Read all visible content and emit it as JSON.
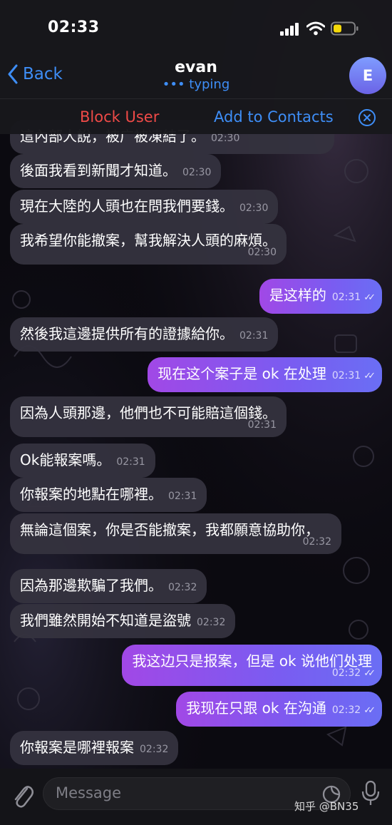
{
  "status_bar": {
    "time": "02:33"
  },
  "nav": {
    "back_label": "Back",
    "title": "evan",
    "subtitle": "typing",
    "avatar_initial": "E"
  },
  "actions": {
    "block_label": "Block User",
    "add_label": "Add to Contacts"
  },
  "messages": [
    {
      "dir": "in",
      "text": "這內部人說，被广被凍結了。",
      "time": "02:30"
    },
    {
      "dir": "in",
      "text": "後面我看到新聞才知道。",
      "time": "02:30"
    },
    {
      "dir": "in",
      "text": "現在大陸的人頭也在問我們要錢。",
      "time": "02:30"
    },
    {
      "dir": "in",
      "text": "我希望你能撤案，幫我解決人頭的麻煩。",
      "time": "02:30"
    },
    {
      "dir": "out",
      "text": "是这样的",
      "time": "02:31"
    },
    {
      "dir": "in",
      "text": "然後我這邊提供所有的證據給你。",
      "time": "02:31"
    },
    {
      "dir": "out",
      "text": "现在这个案子是 ok 在处理",
      "time": "02:31"
    },
    {
      "dir": "in",
      "text": "因為人頭那邊，他們也不可能賠這個錢。",
      "time": "02:31"
    },
    {
      "dir": "in",
      "text": "Ok能報案嗎。",
      "time": "02:31"
    },
    {
      "dir": "in",
      "text": "你報案的地點在哪裡。",
      "time": "02:31"
    },
    {
      "dir": "in",
      "text": "無論這個案，你是否能撤案，我都願意協助你，",
      "time": "02:32"
    },
    {
      "dir": "in",
      "text": "因為那邊欺騙了我們。",
      "time": "02:32"
    },
    {
      "dir": "in",
      "text": "我們雖然開始不知道是盜號",
      "time": "02:32"
    },
    {
      "dir": "out",
      "text": "我这边只是报案，但是 ok 说他们处理",
      "time": "02:32"
    },
    {
      "dir": "out",
      "text": "我现在只跟 ok 在沟通",
      "time": "02:32"
    },
    {
      "dir": "in",
      "text": "你報案是哪裡報案",
      "time": "02:32"
    }
  ],
  "input": {
    "placeholder": "Message"
  },
  "watermark": "知乎 @BN35",
  "colors": {
    "accent": "#3e8ef7",
    "block_red": "#ef4a47",
    "incoming_bubble": "#34323e",
    "outgoing_gradient_start": "#a148e6",
    "outgoing_gradient_end": "#6a6ef4"
  }
}
